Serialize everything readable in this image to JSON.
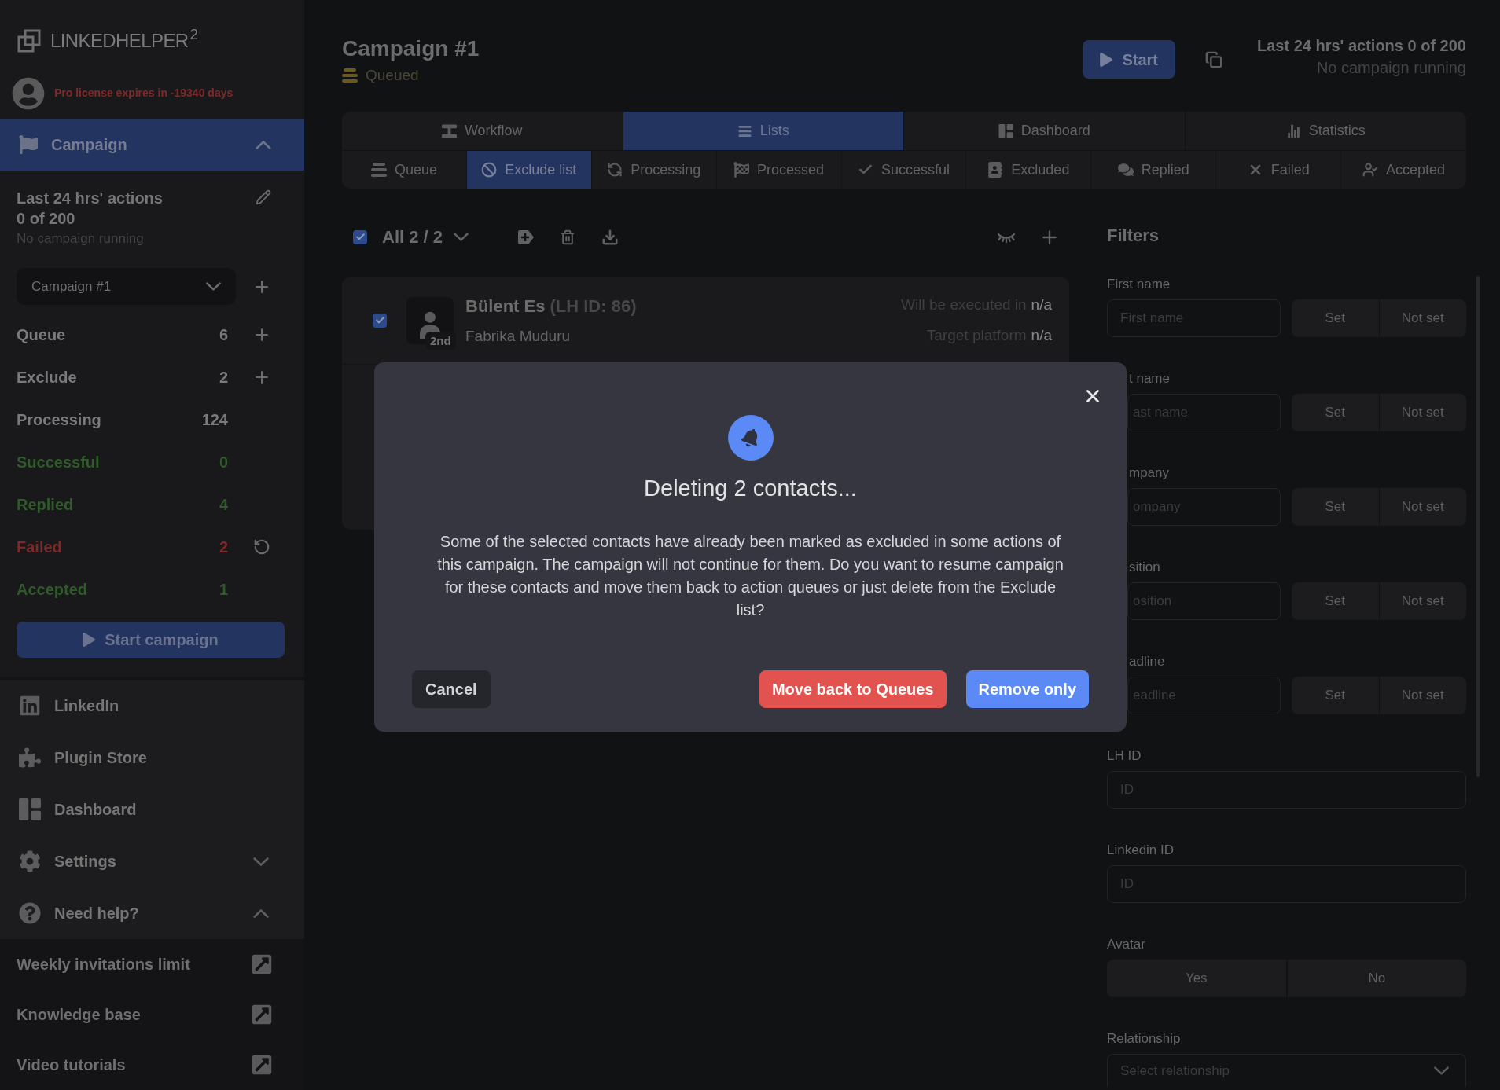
{
  "sidebar": {
    "logo": "LINKEDHELPER$^{2}$",
    "license": "Pro license expires in -19340 days",
    "campaign": {
      "title": "Campaign",
      "expanded": true,
      "actions_title": "Last 24 hrs' actions",
      "actions_count": "0 of 200",
      "status": "No campaign running",
      "select": {
        "value": "Campaign #1"
      },
      "stats": [
        {
          "label": "Queue",
          "count": "6",
          "kind": "add",
          "color": "#7a7a7a"
        },
        {
          "label": "Exclude",
          "count": "2",
          "kind": "add",
          "color": "#7a7a7a"
        },
        {
          "label": "Processing",
          "count": "124",
          "kind": "plain",
          "color": "#7a7a7a"
        },
        {
          "label": "Successful",
          "count": "0",
          "kind": "plain",
          "color": "#2f5a29"
        },
        {
          "label": "Replied",
          "count": "4",
          "kind": "plain",
          "color": "#2f5a29"
        },
        {
          "label": "Failed",
          "count": "2",
          "kind": "retry",
          "color": "#7a2a2a"
        },
        {
          "label": "Accepted",
          "count": "1",
          "kind": "plain",
          "color": "#2f5a29"
        }
      ],
      "start_button": "Start campaign"
    },
    "nav": [
      {
        "label": "LinkedIn",
        "kind": "link"
      },
      {
        "label": "Plugin Store",
        "kind": "link"
      },
      {
        "label": "Dashboard",
        "kind": "link"
      },
      {
        "label": "Settings",
        "kind": "group",
        "expanded": false
      },
      {
        "label": "Need help?",
        "kind": "group",
        "expanded": true,
        "children": [
          {
            "label": "Weekly invitations limit"
          },
          {
            "label": "Knowledge base"
          },
          {
            "label": "Video tutorials"
          }
        ]
      }
    ]
  },
  "header": {
    "title": "Campaign #1",
    "status": "Queued",
    "start_button": "Start",
    "actions_summary": "Last 24 hrs' actions 0 of 200",
    "status_note": "No campaign running"
  },
  "tabs": [
    {
      "label": "Workflow",
      "selected": false
    },
    {
      "label": "Lists",
      "selected": true
    },
    {
      "label": "Dashboard",
      "selected": false
    },
    {
      "label": "Statistics",
      "selected": false
    }
  ],
  "subtabs": [
    {
      "label": "Queue",
      "selected": false
    },
    {
      "label": "Exclude list",
      "selected": true
    },
    {
      "label": "Processing",
      "selected": false
    },
    {
      "label": "Processed",
      "selected": false
    },
    {
      "label": "Successful",
      "selected": false
    },
    {
      "label": "Excluded",
      "selected": false
    },
    {
      "label": "Replied",
      "selected": false
    },
    {
      "label": "Failed",
      "selected": false
    },
    {
      "label": "Accepted",
      "selected": false
    }
  ],
  "toolbar": {
    "checked": true,
    "selection": "All 2 / 2"
  },
  "contacts": [
    {
      "checked": true,
      "name": "Bülent Es",
      "id_note": "(LH ID: 86)",
      "degree": "2nd",
      "headline": "Fabrika Muduru",
      "schedule_label": "Will be executed in",
      "schedule_value": "n/a",
      "platform_label": "Target platform",
      "platform_value": "n/a"
    }
  ],
  "filters": {
    "title": "Filters",
    "fields": [
      {
        "kind": "text_toggle",
        "label": "First name",
        "placeholder": "First name",
        "options": [
          "Set",
          "Not set"
        ]
      },
      {
        "kind": "text_toggle",
        "label": "t name",
        "placeholder": "ast name",
        "options": [
          "Set",
          "Not set"
        ]
      },
      {
        "kind": "text_toggle",
        "label": "mpany",
        "placeholder": "ompany",
        "options": [
          "Set",
          "Not set"
        ]
      },
      {
        "kind": "text_toggle",
        "label": "sition",
        "placeholder": "osition",
        "options": [
          "Set",
          "Not set"
        ]
      },
      {
        "kind": "text_toggle",
        "label": "adline",
        "placeholder": "eadline",
        "options": [
          "Set",
          "Not set"
        ]
      },
      {
        "kind": "text",
        "label": "LH ID",
        "placeholder": "ID"
      },
      {
        "kind": "text",
        "label": "Linkedin ID",
        "placeholder": "ID"
      },
      {
        "kind": "toggle",
        "label": "Avatar",
        "options": [
          "Yes",
          "No"
        ]
      },
      {
        "kind": "select",
        "label": "Relationship",
        "placeholder": "Select relationship"
      }
    ]
  },
  "dialog": {
    "title": "Deleting 2 contacts...",
    "message": "Some of the selected contacts have already been marked as excluded in some actions of this campaign. The campaign will not continue for them. Do you want to resume campaign for these contacts and move them back to action queues or just delete from the Exclude list?",
    "buttons": [
      {
        "label": "Cancel",
        "kind": "secondary"
      },
      {
        "label": "Move back to Queues",
        "kind": "danger"
      },
      {
        "label": "Remove only",
        "kind": "primary"
      }
    ]
  }
}
